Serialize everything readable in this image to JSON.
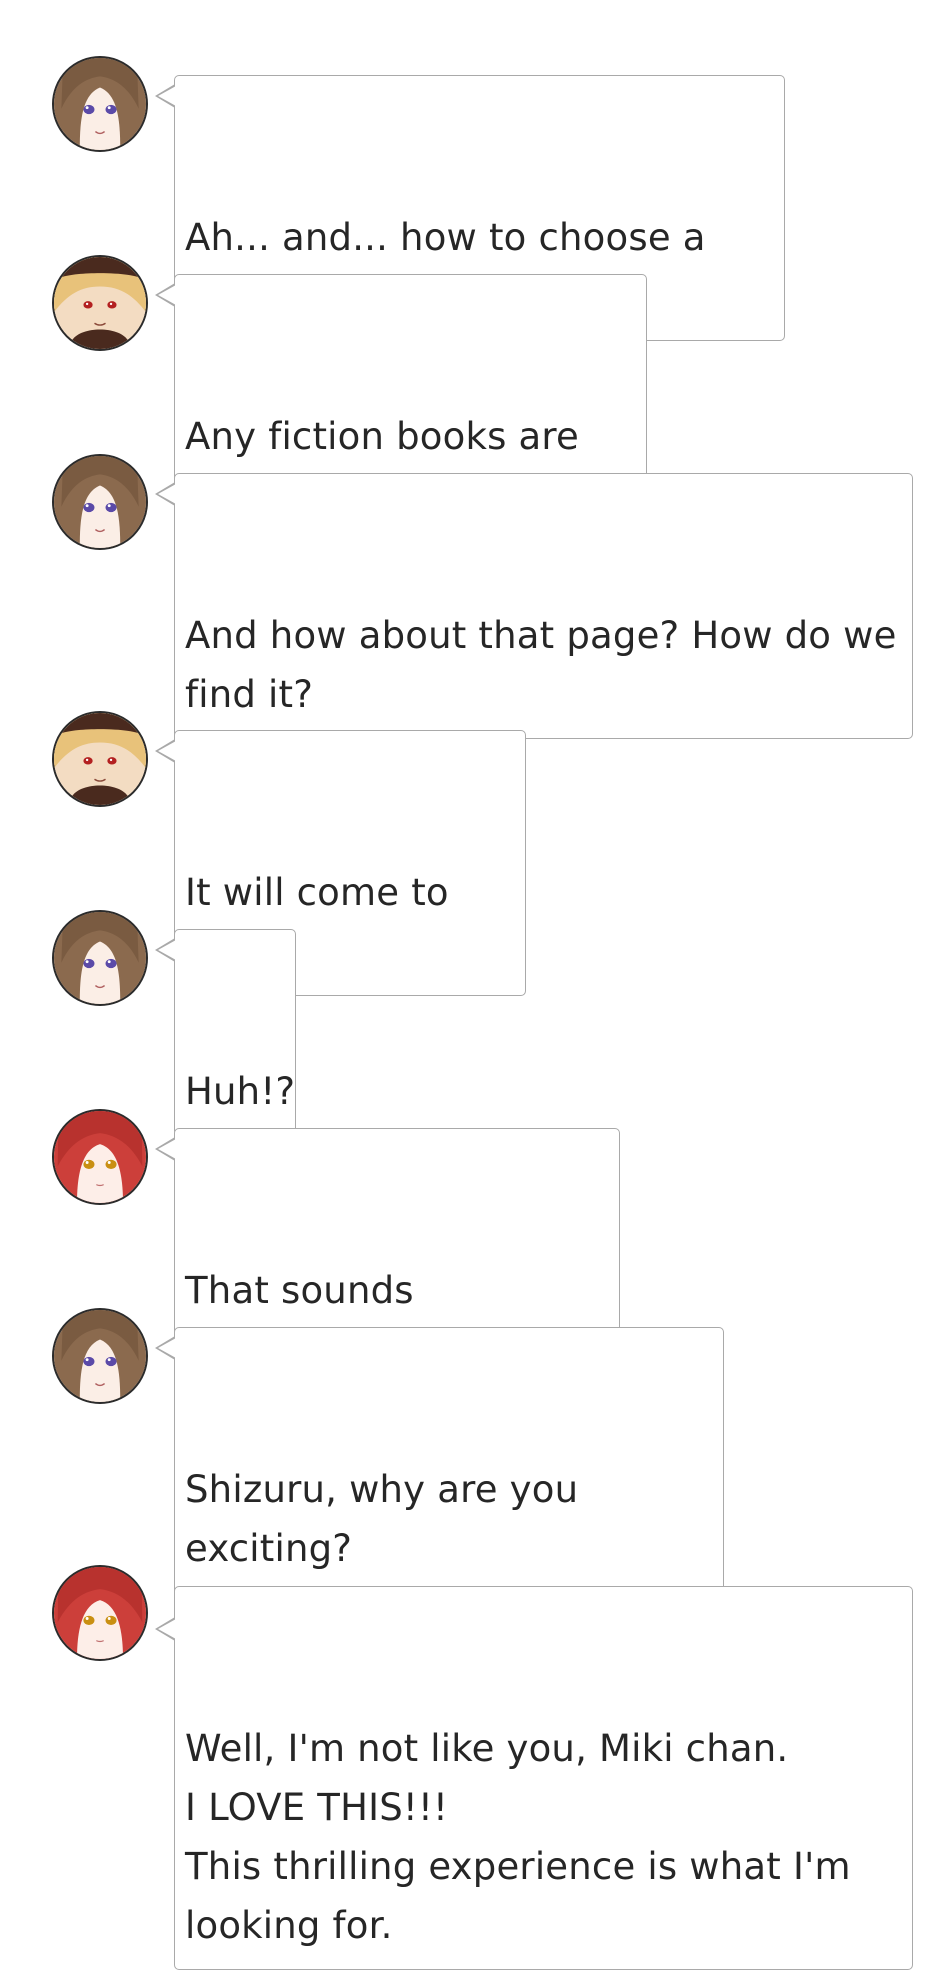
{
  "chat": {
    "messages": [
      {
        "speaker": "miki",
        "text": "Ah... and... how to choose a book?"
      },
      {
        "speaker": "blond",
        "text": "Any fiction books are fine."
      },
      {
        "speaker": "miki",
        "text": "And how about that page? How do we\nfind it?"
      },
      {
        "speaker": "blond",
        "text": "It will come to you."
      },
      {
        "speaker": "miki",
        "text": "Huh!?"
      },
      {
        "speaker": "shizuru",
        "text": "That sounds interesting!"
      },
      {
        "speaker": "miki",
        "text": "Shizuru, why are you exciting?\nDon't you feel any suspicious?"
      },
      {
        "speaker": "shizuru",
        "text": "Well, I'm not like you, Miki chan.\nI LOVE THIS!!!\nThis thrilling experience is what I'm\nlooking for."
      }
    ]
  },
  "colors": {
    "bubble_border": "#a9a9a9",
    "text": "#262626",
    "miki_hair": "#8b6a4e",
    "blond_hair": "#e8c27a",
    "shizuru_hair": "#cc3f3a"
  },
  "icons": {
    "miki": "miki-avatar-icon",
    "blond": "blond-boy-avatar-icon",
    "shizuru": "shizuru-avatar-icon"
  }
}
